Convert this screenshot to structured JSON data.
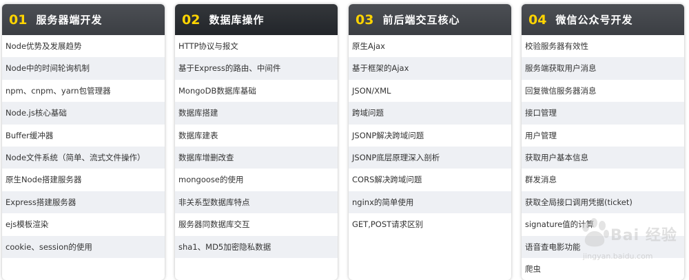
{
  "cards": [
    {
      "number": "01",
      "title": "服务器端开发",
      "items": [
        "Node优势及发展趋势",
        "Node中的时间轮询机制",
        "npm、cnpm、yarn包管理器",
        "Node.js核心基础",
        "Buffer缓冲器",
        "Node文件系统（简单、流式文件操作）",
        "原生Node搭建服务器",
        "Express搭建服务器",
        "ejs模板渲染",
        "cookie、session的使用"
      ]
    },
    {
      "number": "02",
      "title": "数据库操作",
      "items": [
        "HTTP协议与报文",
        "基于Express的路由、中间件",
        "MongoDB数据库基础",
        "数据库搭建",
        "数据库建表",
        "数据库增删改查",
        "mongoose的使用",
        "非关系型数据库特点",
        "服务器同数据库交互",
        "sha1、MD5加密隐私数据"
      ]
    },
    {
      "number": "03",
      "title": "前后端交互核心",
      "items": [
        "原生Ajax",
        "基于框架的Ajax",
        "JSON/XML",
        "跨域问题",
        "JSONP解决跨域问题",
        "JSONP底层原理深入剖析",
        "CORS解决跨域问题",
        "nginx的简单使用",
        "GET,POST请求区别"
      ]
    },
    {
      "number": "04",
      "title": "微信公众号开发",
      "items": [
        "校验服务器有效性",
        "服务端获取用户消息",
        "回复微信服务器消息",
        "接口管理",
        "用户管理",
        "获取用户基本信息",
        "群发消息",
        "获取全局接口调用凭据(ticket)",
        "signature值的计算",
        "语音查电影功能",
        "爬虫"
      ]
    }
  ],
  "watermark": {
    "brand": "Bai 经验",
    "url": "jingyan.baidu.com"
  },
  "colors": {
    "header_dark": "#3b3e43",
    "header_darker": "#22252a",
    "number_accent": "#ffd400",
    "row_stripe": "#eef0f4",
    "text": "#333333"
  }
}
